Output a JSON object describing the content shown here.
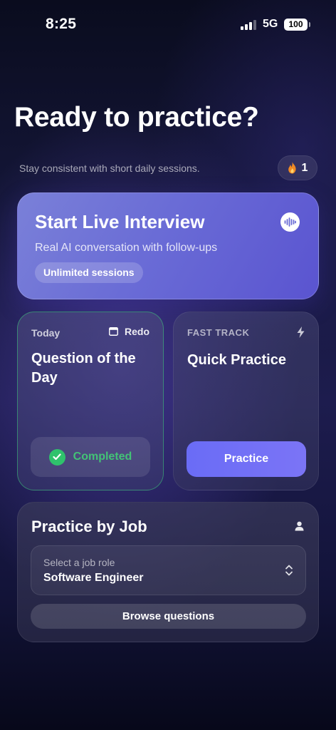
{
  "status_bar": {
    "time": "8:25",
    "network": "5G",
    "battery": "100"
  },
  "header": {
    "title": "Ready to practice?",
    "subtitle": "Stay consistent with short daily sessions.",
    "streak_icon": "flame-icon",
    "streak_count": "1"
  },
  "live_interview": {
    "title": "Start Live Interview",
    "description": "Real AI conversation with follow-ups",
    "badge": "Unlimited sessions",
    "icon": "audio-wave-icon"
  },
  "question_of_day": {
    "tag": "Today",
    "redo_label": "Redo",
    "title": "Question of the Day",
    "status_label": "Completed",
    "status_color": "#43c276"
  },
  "quick_practice": {
    "tag": "FAST TRACK",
    "title": "Quick Practice",
    "button_label": "Practice",
    "icon": "bolt-icon"
  },
  "practice_by_job": {
    "title": "Practice by Job",
    "select_label": "Select a job role",
    "select_value": "Software Engineer",
    "browse_label": "Browse questions",
    "icon": "user-icon"
  },
  "colors": {
    "accent": "#6a6cf6",
    "success": "#2fc26c",
    "card_live": "#6a6cd6"
  }
}
